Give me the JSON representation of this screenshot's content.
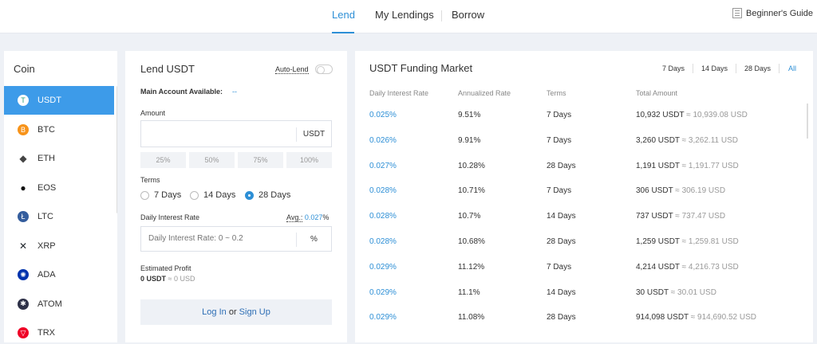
{
  "topnav": {
    "tabs": [
      "Lend",
      "My Lendings",
      "Borrow"
    ],
    "guide": "Beginner's Guide"
  },
  "coins": {
    "title": "Coin",
    "items": [
      {
        "name": "USDT",
        "icon": "usdt-icon",
        "color": "#26a17b",
        "active": true
      },
      {
        "name": "BTC",
        "icon": "btc-icon",
        "color": "#f7931a"
      },
      {
        "name": "ETH",
        "icon": "eth-icon",
        "color": "#444444"
      },
      {
        "name": "EOS",
        "icon": "eos-icon",
        "color": "#111111"
      },
      {
        "name": "LTC",
        "icon": "ltc-icon",
        "color": "#345d9d"
      },
      {
        "name": "XRP",
        "icon": "xrp-icon",
        "color": "#23292f"
      },
      {
        "name": "ADA",
        "icon": "ada-icon",
        "color": "#0033ad"
      },
      {
        "name": "ATOM",
        "icon": "atom-icon",
        "color": "#2e3148"
      },
      {
        "name": "TRX",
        "icon": "trx-icon",
        "color": "#ef0027"
      }
    ]
  },
  "lend": {
    "title": "Lend USDT",
    "auto_lend": "Auto-Lend",
    "main_account_label": "Main Account Available:",
    "main_account_value": "--",
    "amount_label": "Amount",
    "amount_unit": "USDT",
    "percent_options": [
      "25%",
      "50%",
      "75%",
      "100%"
    ],
    "terms_label": "Terms",
    "terms": [
      {
        "label": "7 Days",
        "selected": false
      },
      {
        "label": "14 Days",
        "selected": false
      },
      {
        "label": "28 Days",
        "selected": true
      }
    ],
    "rate_label": "Daily Interest Rate",
    "avg_label": "Avg.:",
    "avg_value": "0.027",
    "avg_unit": "%",
    "rate_placeholder": "Daily Interest Rate: 0 ~ 0.2",
    "rate_unit": "%",
    "profit_label": "Estimated Profit",
    "profit_usdt": "0 USDT",
    "profit_usd": "≈ 0 USD",
    "login": "Log In",
    "or": "or",
    "signup": "Sign Up"
  },
  "market": {
    "title": "USDT Funding Market",
    "filters": [
      "7 Days",
      "14 Days",
      "28 Days",
      "All"
    ],
    "headers": [
      "Daily Interest Rate",
      "Annualized Rate",
      "Terms",
      "Total Amount"
    ],
    "rows": [
      {
        "rate": "0.025%",
        "ann": "9.51%",
        "term": "7 Days",
        "total": "10,932 USDT",
        "usd": "≈ 10,939.08 USD"
      },
      {
        "rate": "0.026%",
        "ann": "9.91%",
        "term": "7 Days",
        "total": "3,260 USDT",
        "usd": "≈ 3,262.11 USD"
      },
      {
        "rate": "0.027%",
        "ann": "10.28%",
        "term": "28 Days",
        "total": "1,191 USDT",
        "usd": "≈ 1,191.77 USD"
      },
      {
        "rate": "0.028%",
        "ann": "10.71%",
        "term": "7 Days",
        "total": "306 USDT",
        "usd": "≈ 306.19 USD"
      },
      {
        "rate": "0.028%",
        "ann": "10.7%",
        "term": "14 Days",
        "total": "737 USDT",
        "usd": "≈ 737.47 USD"
      },
      {
        "rate": "0.028%",
        "ann": "10.68%",
        "term": "28 Days",
        "total": "1,259 USDT",
        "usd": "≈ 1,259.81 USD"
      },
      {
        "rate": "0.029%",
        "ann": "11.12%",
        "term": "7 Days",
        "total": "4,214 USDT",
        "usd": "≈ 4,216.73 USD"
      },
      {
        "rate": "0.029%",
        "ann": "11.1%",
        "term": "14 Days",
        "total": "30 USDT",
        "usd": "≈ 30.01 USD"
      },
      {
        "rate": "0.029%",
        "ann": "11.08%",
        "term": "28 Days",
        "total": "914,098 USDT",
        "usd": "≈ 914,690.52 USD"
      }
    ]
  }
}
